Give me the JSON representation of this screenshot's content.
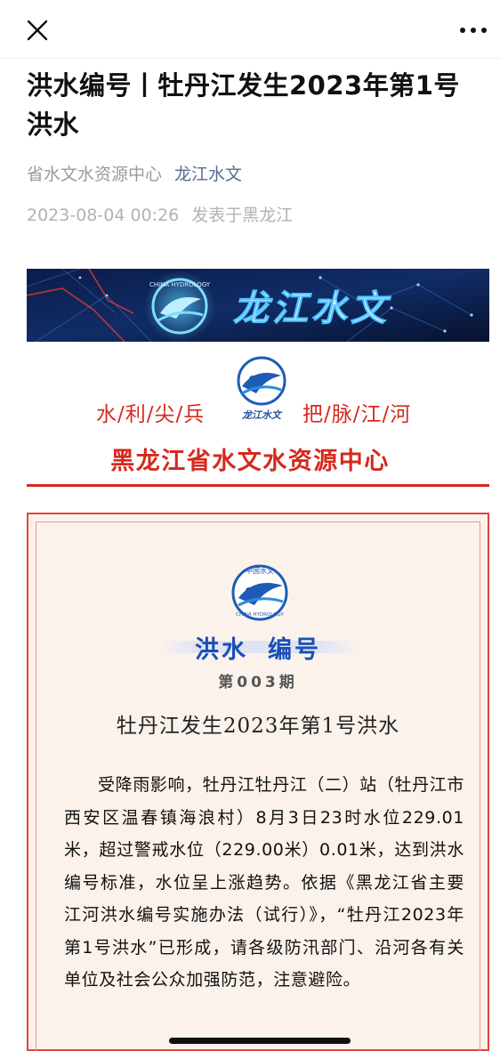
{
  "nav": {
    "close_icon": "close-icon",
    "more_icon": "more-dots-icon"
  },
  "article": {
    "title": "洪水编号丨牡丹江发生2023年第1号洪水",
    "source": "省水文水资源中心",
    "account": "龙江水文",
    "datetime": "2023-08-04 00:26",
    "location": "发表于黑龙江"
  },
  "banner": {
    "text": "龙江水文",
    "logo_text": "CHINA HYDROLOGY"
  },
  "header": {
    "slogan_left": "水/利/尖/兵",
    "slogan_right": "把/脉/江/河",
    "logo_caption": "龙江水文",
    "org_name": "黑龙江省水文水资源中心"
  },
  "document": {
    "logo_top": "中国水文",
    "logo_bottom": "CHINA HYDROLOGY",
    "heading_part1": "洪水",
    "heading_part2": "编号",
    "issue": "第003期",
    "title": "牡丹江发生2023年第1号洪水",
    "body": "受降雨影响，牡丹江牡丹江（二）站（牡丹江市西安区温春镇海浪村）8月3日23时水位229.01米，超过警戒水位（229.00米）0.01米，达到洪水编号标准，水位呈上涨趋势。依据《黑龙江省主要江河洪水编号实施办法（试行）》，“牡丹江2023年第1号洪水”已形成，请各级防汛部门、沿河各有关单位及社会公众加强防范，注意避险。"
  },
  "colors": {
    "accent_red": "#d42a1e",
    "link_blue": "#576b95",
    "heading_blue": "#1a4fb4"
  }
}
